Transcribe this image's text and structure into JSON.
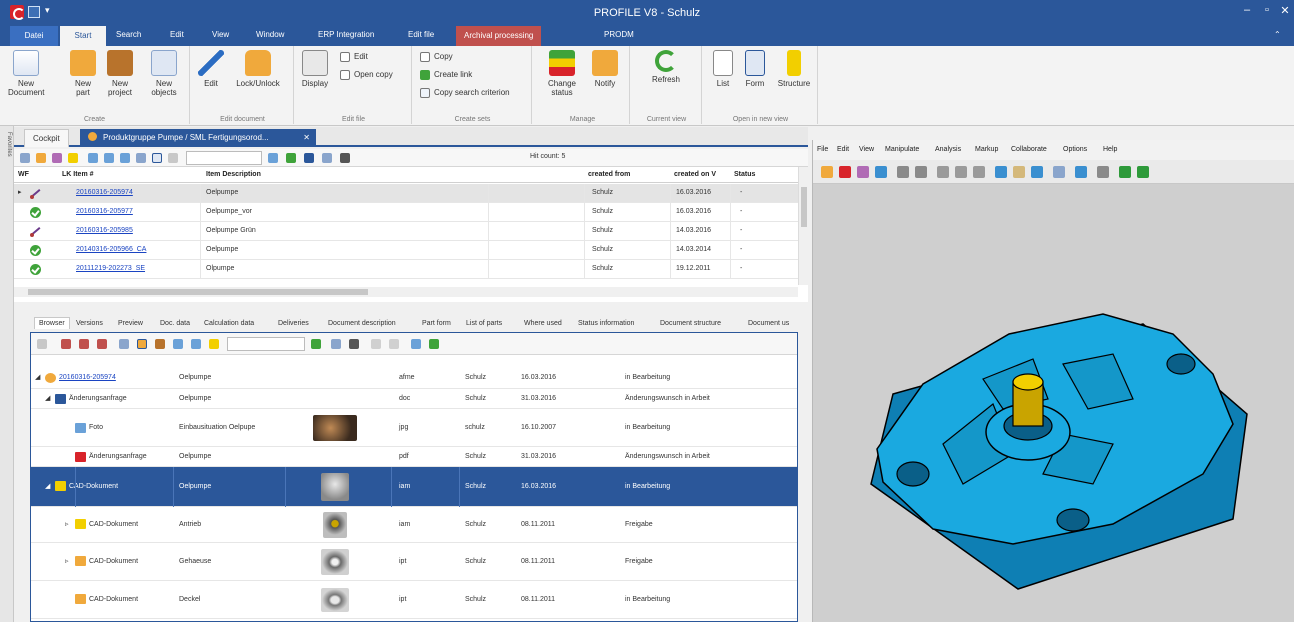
{
  "window": {
    "title": "PROFILE V8 - Schulz"
  },
  "ribbon_tabs": [
    {
      "label": "Datei"
    },
    {
      "label": "Start"
    },
    {
      "label": "Search"
    },
    {
      "label": "Edit"
    },
    {
      "label": "View"
    },
    {
      "label": "Window"
    },
    {
      "label": "ERP Integration"
    },
    {
      "label": "Edit file"
    },
    {
      "label": "Archival processing"
    },
    {
      "label": "PRODM"
    }
  ],
  "ribbon": {
    "groups": {
      "create": "Create",
      "edit_document": "Edit document",
      "edit_file": "Edit file",
      "create_sets": "Create sets",
      "manage": "Manage",
      "current_view": "Current view",
      "open_in_new_view": "Open in new view"
    },
    "buttons": {
      "new_document": "New Document",
      "new_part": "New part",
      "new_project": "New project",
      "new_objects": "New objects",
      "edit": "Edit",
      "lock_unlock": "Lock/Unlock",
      "display": "Display",
      "file_edit": "Edit",
      "open_copy": "Open copy",
      "copy": "Copy",
      "create_link": "Create link",
      "copy_search_criterion": "Copy search criterion",
      "change_status": "Change status",
      "notify": "Notify",
      "refresh": "Refresh",
      "list": "List",
      "form": "Form",
      "structure": "Structure"
    }
  },
  "side_strip": {
    "label": "Favorites"
  },
  "doc_tabs": {
    "cockpit": "Cockpit",
    "active": "Produktgruppe Pumpe / SML Fertigungsorod...",
    "close": "✕"
  },
  "upper_grid": {
    "hit_count": "Hit count: 5",
    "columns": {
      "wf": "WF",
      "lk_item": "LK Item #",
      "item_description": "Item Description",
      "created_from": "created from",
      "created_on": "created on V",
      "status": "Status"
    },
    "rows": [
      {
        "item": "20160316-205974",
        "description": "Oelpumpe",
        "created_from": "Schulz",
        "created_on": "16.03.2016",
        "status": "-",
        "icon": "link"
      },
      {
        "item": "20160316-205977",
        "description": "Oelpumpe_vor",
        "created_from": "Schulz",
        "created_on": "16.03.2016",
        "status": "-",
        "icon": "ok"
      },
      {
        "item": "20160316-205985",
        "description": "Oelpumpe Grün",
        "created_from": "Schulz",
        "created_on": "14.03.2016",
        "status": "-",
        "icon": "link"
      },
      {
        "item": "20140316-205966_CA",
        "description": "Oelpumpe",
        "created_from": "Schulz",
        "created_on": "14.03.2014",
        "status": "-",
        "icon": "ok"
      },
      {
        "item": "20111219-202273_SE",
        "description": "Olpumpe",
        "created_from": "Schulz",
        "created_on": "19.12.2011",
        "status": "-",
        "icon": "ok"
      }
    ]
  },
  "detail_tabs": [
    {
      "label": "Browser"
    },
    {
      "label": "Versions"
    },
    {
      "label": "Preview"
    },
    {
      "label": "Doc. data"
    },
    {
      "label": "Calculation data"
    },
    {
      "label": "Deliveries"
    },
    {
      "label": "Document description"
    },
    {
      "label": "Part form"
    },
    {
      "label": "List of parts"
    },
    {
      "label": "Where used"
    },
    {
      "label": "Status information"
    },
    {
      "label": "Document structure"
    },
    {
      "label": "Document us"
    }
  ],
  "tree_rows": [
    {
      "name": "20160316-205974",
      "description": "Oelpumpe",
      "type": "afme",
      "user": "Schulz",
      "date": "16.03.2016",
      "status": "in Bearbeitung",
      "has_thumb": false
    },
    {
      "name": "Änderungsanfrage",
      "description": "Oelpumpe",
      "type": "doc",
      "user": "Schulz",
      "date": "31.03.2016",
      "status": "Änderungswunsch in Arbeit",
      "has_thumb": false
    },
    {
      "name": "Foto",
      "description": "Einbausituation Oelpupe",
      "type": "jpg",
      "user": "schulz",
      "date": "16.10.2007",
      "status": "in Bearbeitung",
      "has_thumb": true
    },
    {
      "name": "Änderungsanfrage",
      "description": "Oelpumpe",
      "type": "pdf",
      "user": "Schulz",
      "date": "31.03.2016",
      "status": "Änderungswunsch in Arbeit",
      "has_thumb": false
    },
    {
      "name": "CAD-Dokument",
      "description": "Oelpumpe",
      "type": "iam",
      "user": "Schulz",
      "date": "16.03.2016",
      "status": "in Bearbeitung",
      "has_thumb": true
    },
    {
      "name": "CAD-Dokument",
      "description": "Antrieb",
      "type": "iam",
      "user": "Schulz",
      "date": "08.11.2011",
      "status": "Freigabe",
      "has_thumb": true
    },
    {
      "name": "CAD-Dokument",
      "description": "Gehaeuse",
      "type": "ipt",
      "user": "Schulz",
      "date": "08.11.2011",
      "status": "Freigabe",
      "has_thumb": true
    },
    {
      "name": "CAD-Dokument",
      "description": "Deckel",
      "type": "ipt",
      "user": "Schulz",
      "date": "08.11.2011",
      "status": "in Bearbeitung",
      "has_thumb": true
    }
  ],
  "viewer": {
    "menu": [
      {
        "label": "File"
      },
      {
        "label": "Edit"
      },
      {
        "label": "View"
      },
      {
        "label": "Manipulate"
      },
      {
        "label": "Analysis"
      },
      {
        "label": "Markup"
      },
      {
        "label": "Collaborate"
      },
      {
        "label": "Options"
      },
      {
        "label": "Help"
      }
    ],
    "model_color": "#1aa9e0",
    "model_cap_color": "#f2cf00"
  },
  "colors": {
    "accent": "#2b579a",
    "archival_tab": "#c0504d",
    "link": "#1a44c2"
  }
}
